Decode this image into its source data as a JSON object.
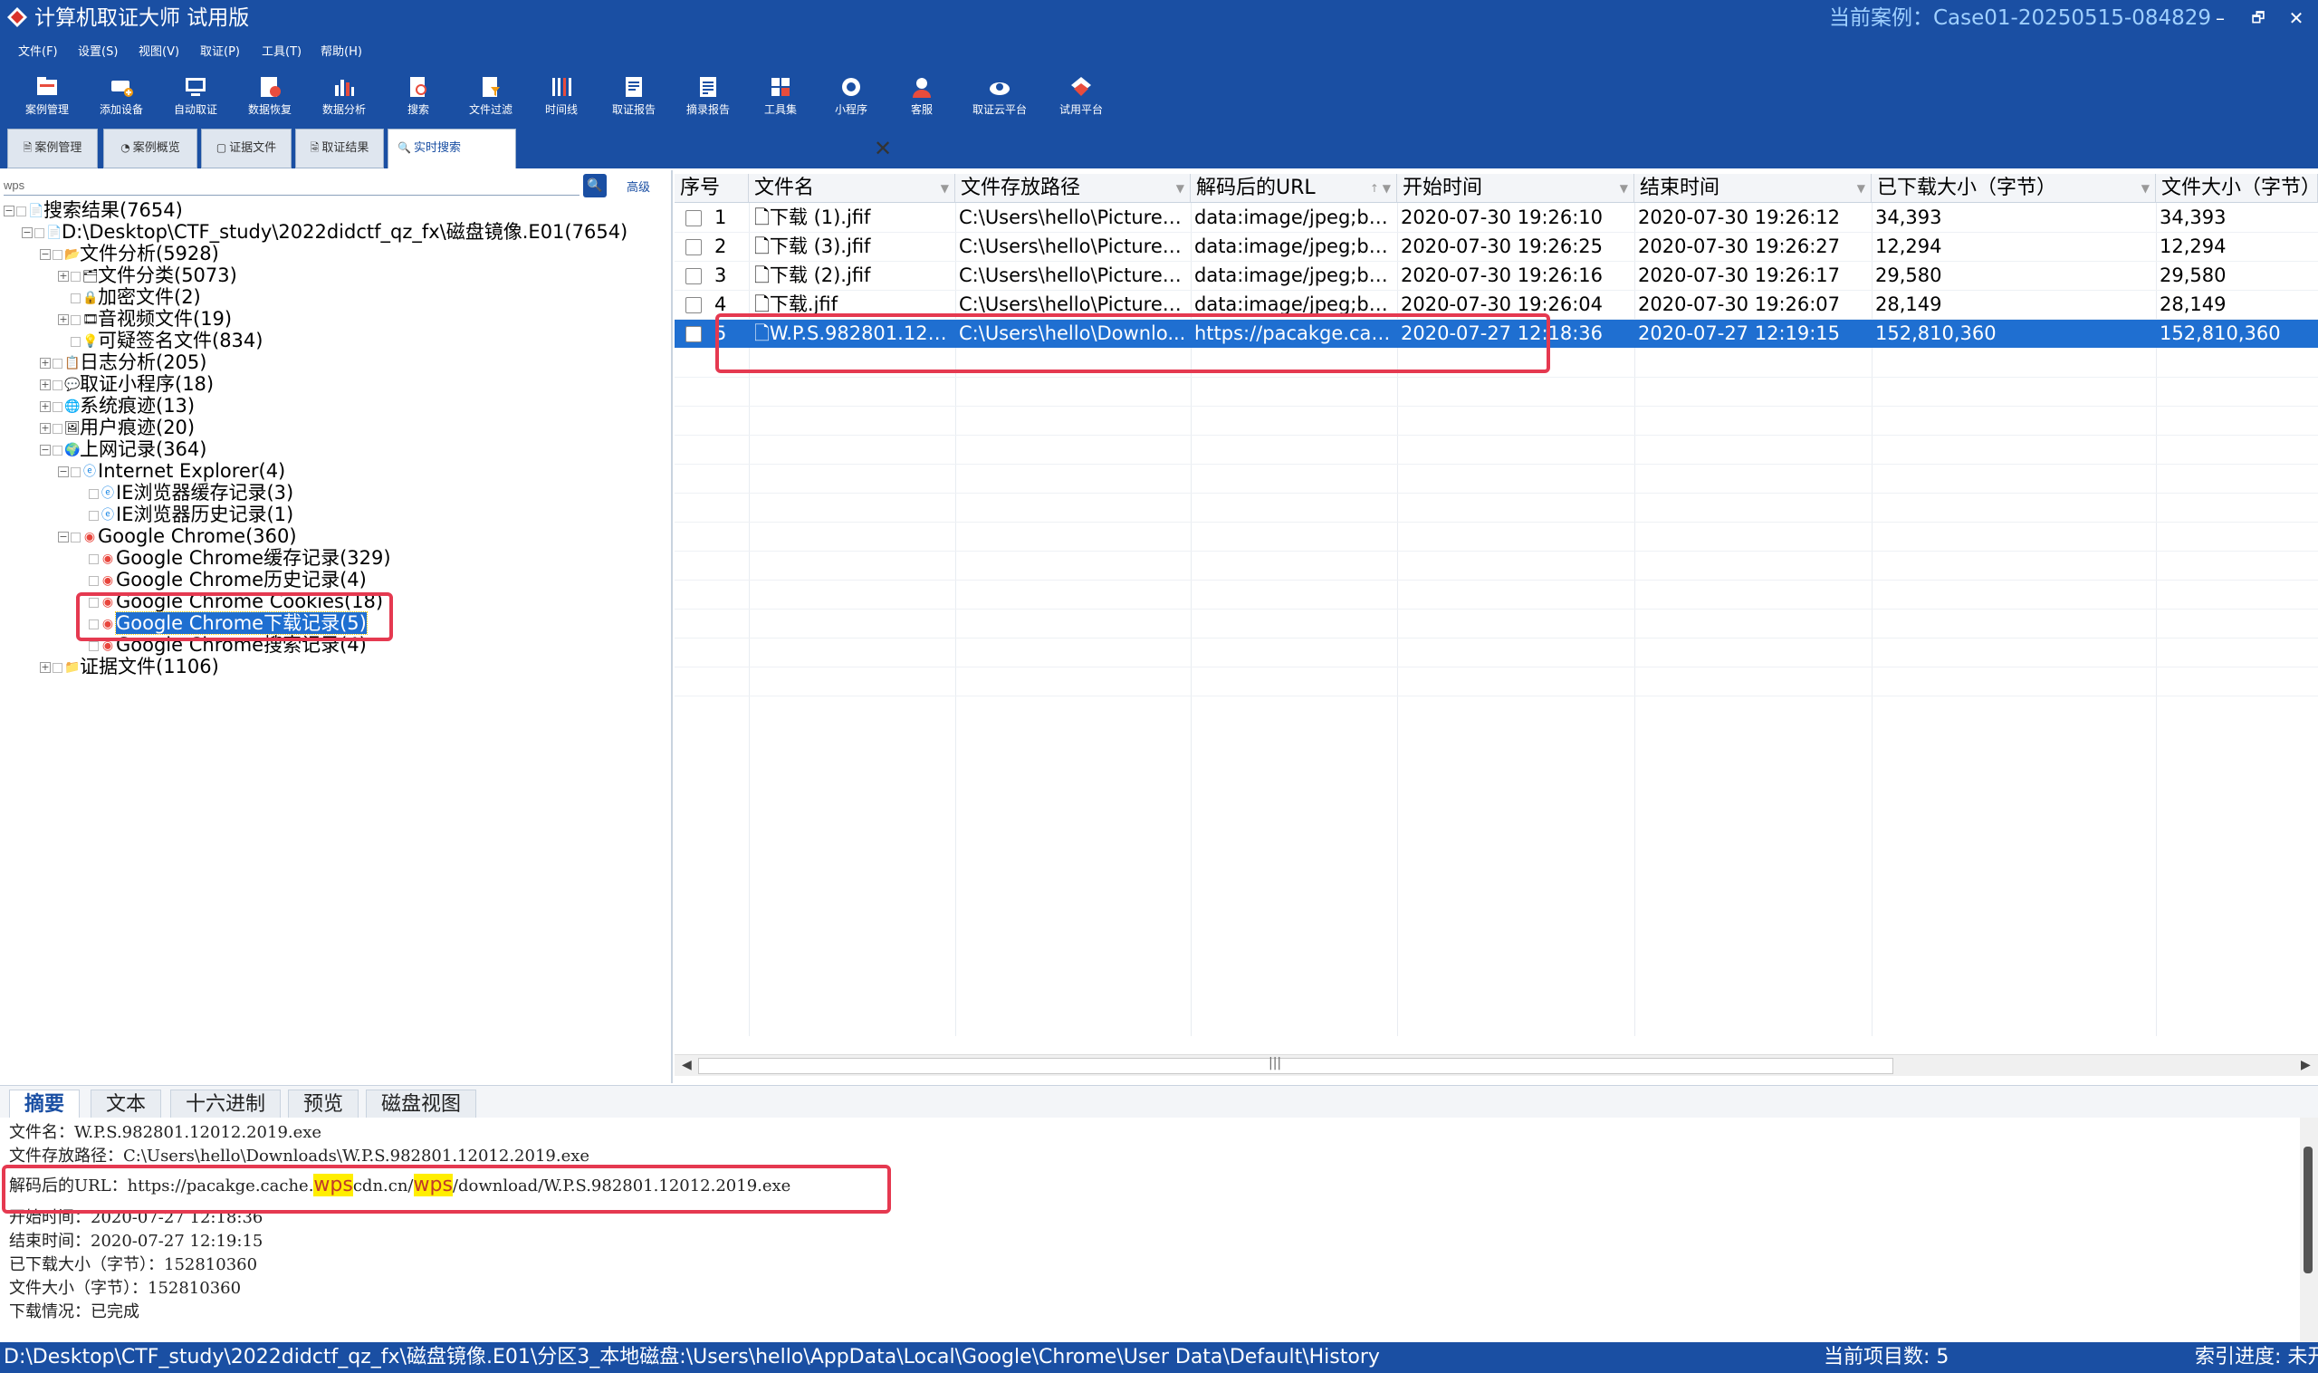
{
  "window": {
    "title": "计算机取证大师 试用版",
    "case_label": "当前案例：Case01-20250515-084829",
    "minimize": "–",
    "restore": "🗗",
    "close": "✕"
  },
  "menu": [
    "文件(F)",
    "设置(S)",
    "视图(V)",
    "取证(P)",
    "工具(T)",
    "帮助(H)"
  ],
  "toolbar": [
    {
      "label": "案例管理",
      "icon": "case-manage-icon"
    },
    {
      "label": "添加设备",
      "icon": "add-device-icon"
    },
    {
      "label": "自动取证",
      "icon": "auto-forensics-icon"
    },
    {
      "label": "数据恢复",
      "icon": "data-recovery-icon"
    },
    {
      "label": "数据分析",
      "icon": "data-analysis-icon"
    },
    {
      "label": "搜索",
      "icon": "search-doc-icon"
    },
    {
      "label": "文件过滤",
      "icon": "file-filter-icon"
    },
    {
      "label": "时间线",
      "icon": "timeline-icon"
    },
    {
      "label": "取证报告",
      "icon": "report-icon"
    },
    {
      "label": "摘录报告",
      "icon": "excerpt-report-icon"
    },
    {
      "label": "工具集",
      "icon": "toolset-icon"
    },
    {
      "label": "小程序",
      "icon": "miniapp-icon"
    },
    {
      "label": "客服",
      "icon": "support-icon"
    },
    {
      "label": "取证云平台",
      "icon": "cloud-icon"
    },
    {
      "label": "试用平台",
      "icon": "trial-icon"
    }
  ],
  "tabs": [
    {
      "label": "案例管理"
    },
    {
      "label": "案例概览"
    },
    {
      "label": "证据文件"
    },
    {
      "label": "取证结果"
    },
    {
      "label": "实时搜索",
      "active": true
    }
  ],
  "search": {
    "value": "wps",
    "button": "🔍",
    "advanced": "高级"
  },
  "tree": [
    {
      "label": "搜索结果(7654)",
      "icon": "📄"
    },
    {
      "label": "D:\\Desktop\\CTF_study\\2022didctf_qz_fx\\磁盘镜像.E01(7654)",
      "icon": "📄"
    },
    {
      "label": "文件分析(5928)",
      "icon": "📂"
    },
    {
      "label": "文件分类(5073)",
      "icon": "🗂"
    },
    {
      "label": "加密文件(2)",
      "icon": "🔒"
    },
    {
      "label": "音视频文件(19)",
      "icon": "🎞"
    },
    {
      "label": "可疑签名文件(834)",
      "icon": "💡"
    },
    {
      "label": "日志分析(205)",
      "icon": "📋"
    },
    {
      "label": "取证小程序(18)",
      "icon": "💬"
    },
    {
      "label": "系统痕迹(13)",
      "icon": "🌐"
    },
    {
      "label": "用户痕迹(20)",
      "icon": "🖼"
    },
    {
      "label": "上网记录(364)",
      "icon": "🌍"
    },
    {
      "label": "Internet Explorer(4)",
      "icon": "ⓔ"
    },
    {
      "label": "IE浏览器缓存记录(3)",
      "icon": "ⓔ"
    },
    {
      "label": "IE浏览器历史记录(1)",
      "icon": "ⓔ"
    },
    {
      "label": "Google Chrome(360)",
      "icon": "◉"
    },
    {
      "label": "Google Chrome缓存记录(329)",
      "icon": "◉"
    },
    {
      "label": "Google Chrome历史记录(4)",
      "icon": "◉"
    },
    {
      "label": "Google Chrome Cookies(18)",
      "icon": "◉"
    },
    {
      "label": "Google Chrome下载记录(5)",
      "icon": "◉"
    },
    {
      "label": "Google Chrome搜索记录(4)",
      "icon": "◉"
    },
    {
      "label": "证据文件(1106)",
      "icon": "📁"
    }
  ],
  "grid": {
    "columns": [
      "序号",
      "文件名",
      "文件存放路径",
      "解码后的URL",
      "开始时间",
      "结束时间",
      "已下载大小（字节）",
      "文件大小（字节）"
    ],
    "rows": [
      {
        "no": "1",
        "name": "下载 (1).jfif",
        "path": "C:\\Users\\hello\\Pictures\\...",
        "url": "data:image/jpeg;bas...",
        "start": "2020-07-30 19:26:10",
        "end": "2020-07-30 19:26:12",
        "downloaded": "34,393",
        "size": "34,393"
      },
      {
        "no": "2",
        "name": "下载 (3).jfif",
        "path": "C:\\Users\\hello\\Pictures\\...",
        "url": "data:image/jpeg;bas...",
        "start": "2020-07-30 19:26:25",
        "end": "2020-07-30 19:26:27",
        "downloaded": "12,294",
        "size": "12,294"
      },
      {
        "no": "3",
        "name": "下载 (2).jfif",
        "path": "C:\\Users\\hello\\Pictures\\...",
        "url": "data:image/jpeg;bas...",
        "start": "2020-07-30 19:26:16",
        "end": "2020-07-30 19:26:17",
        "downloaded": "29,580",
        "size": "29,580"
      },
      {
        "no": "4",
        "name": "下载.jfif",
        "path": "C:\\Users\\hello\\Pictures\\...",
        "url": "data:image/jpeg;bas...",
        "start": "2020-07-30 19:26:04",
        "end": "2020-07-30 19:26:07",
        "downloaded": "28,149",
        "size": "28,149"
      },
      {
        "no": "5",
        "name": "W.P.S.982801.120...",
        "path": "C:\\Users\\hello\\Downlo...",
        "url": "https://pacakge.cac...",
        "start": "2020-07-27 12:18:36",
        "end": "2020-07-27 12:19:15",
        "downloaded": "152,810,360",
        "size": "152,810,360"
      }
    ]
  },
  "detail": {
    "tabs": [
      "摘要",
      "文本",
      "十六进制",
      "预览",
      "磁盘视图"
    ],
    "lines": [
      "文件名：W.P.S.982801.12012.2019.exe",
      "文件存放路径：C:\\Users\\hello\\Downloads\\W.P.S.982801.12012.2019.exe",
      "开始时间：2020-07-27  12:18:36",
      "结束时间：2020-07-27  12:19:15",
      "已下载大小（字节）：152810360",
      "文件大小（字节）：152810360",
      "下载情况：已完成"
    ],
    "url_line": {
      "prefix": "解码后的URL：https://pacakge.cache.",
      "hl1": "wps",
      "mid": "cdn.cn/",
      "hl2": "wps",
      "suffix": "/download/W.P.S.982801.12012.2019.exe"
    }
  },
  "status": {
    "path": "D:\\Desktop\\CTF_study\\2022didctf_qz_fx\\磁盘镜像.E01\\分区3_本地磁盘:\\Users\\hello\\AppData\\Local\\Google\\Chrome\\User Data\\Default\\History",
    "count": "当前项目数: 5",
    "progress": "索引进度: 未开"
  }
}
